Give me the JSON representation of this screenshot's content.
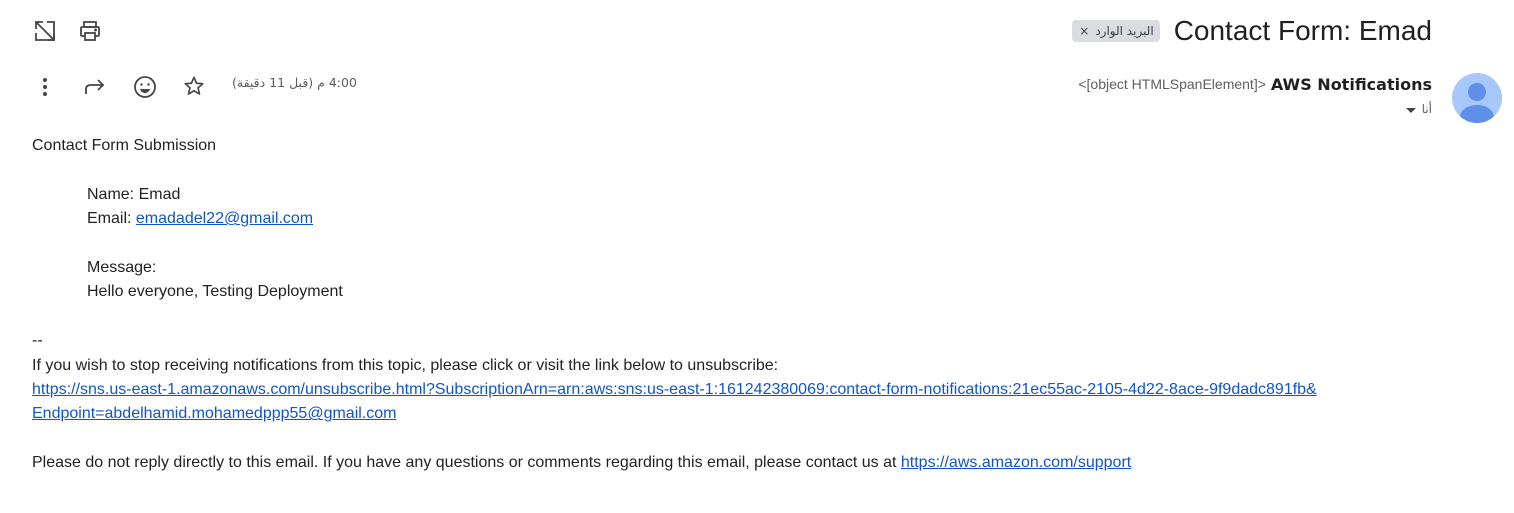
{
  "toolbar": {
    "open_new_window_icon": "open-in-new-window-icon",
    "print_icon": "printer-icon"
  },
  "header": {
    "subject": "Contact Form: Emad",
    "label_chip": "البريد الوارد",
    "label_chip_remove": "×"
  },
  "sender": {
    "name": "AWS Notifications",
    "email": "<[object HTMLSpanElement]>"
  },
  "recipient": {
    "label": "أنا"
  },
  "message_meta": {
    "timestamp": "4:00 م (قبل 11 دقيقة)"
  },
  "actions": {
    "more_icon": "more-vertical-icon",
    "forward_icon": "forward-icon",
    "emoji_icon": "emoji-reaction-icon",
    "star_icon": "star-icon"
  },
  "body": {
    "title": "Contact Form Submission",
    "name_line": "Name: Emad",
    "email_label": "Email: ",
    "email_link": "emadadel22@gmail.com",
    "message_label": "Message:",
    "message_text": "Hello everyone, Testing Deployment",
    "separator": "--",
    "unsubscribe_notice": "If you wish to stop receiving notifications from this topic, please click or visit the link below to unsubscribe:",
    "unsubscribe_link_line1": "https://sns.us-east-1.amazonaws.com/unsubscribe.html?SubscriptionArn=arn:aws:sns:us-east-1:161242380069:contact-form-notifications:21ec55ac-2105-4d22-8ace-9f9dadc891fb&",
    "unsubscribe_link_line2": "Endpoint=abdelhamid.mohamedppp55@gmail.com",
    "footer_text": "Please do not reply directly to this email. If you have any questions or comments regarding this email, please contact us at ",
    "support_link": "https://aws.amazon.com/support"
  },
  "colors": {
    "link": "#1155cc",
    "text": "#222222",
    "chip_bg": "#dadce0",
    "avatar_bg": "#a8c7fa",
    "avatar_fg": "#5f8fe8"
  }
}
